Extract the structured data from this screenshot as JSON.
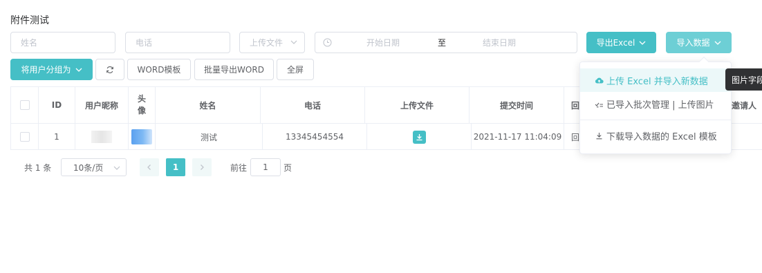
{
  "page": {
    "title": "附件测试"
  },
  "filters": {
    "name_placeholder": "姓名",
    "phone_placeholder": "电话",
    "upload_placeholder": "上传文件",
    "date_start_placeholder": "开始日期",
    "date_separator": "至",
    "date_end_placeholder": "结束日期"
  },
  "toolbar": {
    "export_excel": "导出Excel",
    "import_data": "导入数据",
    "group_users": "将用户分组为",
    "word_template": "WORD模板",
    "batch_export_word": "批量导出WORD",
    "fullscreen": "全屏"
  },
  "table": {
    "headers": {
      "id": "ID",
      "nickname": "用户昵称",
      "avatar_line1": "头",
      "avatar_line2": "像",
      "name": "姓名",
      "phone": "电话",
      "upload": "上传文件",
      "submit_time": "提交时间",
      "reply": "回",
      "inviter": "邀请人"
    },
    "rows": [
      {
        "id": "1",
        "name": "测试",
        "phone": "13345454554",
        "submit_time": "2021-11-17 11:04:09",
        "reply": "回"
      }
    ]
  },
  "pagination": {
    "total": "共 1 条",
    "page_size": "10条/页",
    "current_page": "1",
    "goto_label": "前往",
    "goto_value": "1",
    "goto_unit": "页"
  },
  "import_menu": {
    "items": [
      {
        "label": "上传 Excel 并导入新数据",
        "icon": "cloud-upload-icon"
      },
      {
        "label": "已导入批次管理 | 上传图片",
        "icon": "check-list-icon"
      },
      {
        "label": "下载导入数据的 Excel 模板",
        "icon": "download-icon"
      }
    ]
  },
  "tooltip": {
    "text": "图片字段"
  },
  "colors": {
    "primary": "#45bfc6",
    "primary_light": "#6dcfd5",
    "border": "#dcdfe6",
    "text": "#606266"
  }
}
